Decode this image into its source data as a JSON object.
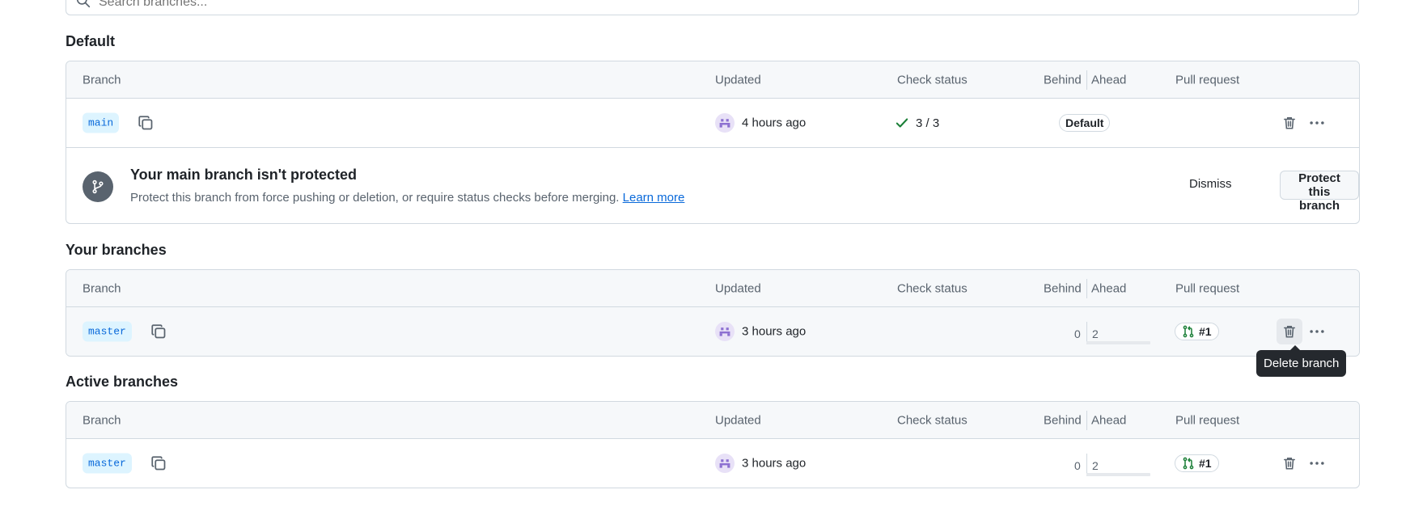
{
  "search": {
    "placeholder": "Search branches..."
  },
  "column_headers": {
    "branch": "Branch",
    "updated": "Updated",
    "check_status": "Check status",
    "behind": "Behind",
    "ahead": "Ahead",
    "pull_request": "Pull request"
  },
  "sections": {
    "default": {
      "title": "Default",
      "row": {
        "branch": "main",
        "updated": "4 hours ago",
        "check": "3 / 3",
        "badge": "Default"
      },
      "alert": {
        "title": "Your main branch isn't protected",
        "description": "Protect this branch from force pushing or deletion, or require status checks before merging.",
        "link": "Learn more",
        "dismiss": "Dismiss",
        "protect": "Protect this branch"
      }
    },
    "yours": {
      "title": "Your branches",
      "row": {
        "branch": "master",
        "updated": "3 hours ago",
        "behind": "0",
        "ahead": "2",
        "pr": "#1"
      }
    },
    "active": {
      "title": "Active branches",
      "row": {
        "branch": "master",
        "updated": "3 hours ago",
        "behind": "0",
        "ahead": "2",
        "pr": "#1"
      }
    }
  },
  "tooltip": "Delete branch",
  "colors": {
    "accent": "#0969da",
    "branch_bg": "#ddf4ff",
    "success": "#1a7f37",
    "tooltip_bg": "#25292e"
  },
  "icons": [
    "search-icon",
    "copy-icon",
    "avatar-icon",
    "check-icon",
    "git-branch-icon",
    "git-pull-request-icon",
    "trash-icon",
    "kebab-icon"
  ]
}
